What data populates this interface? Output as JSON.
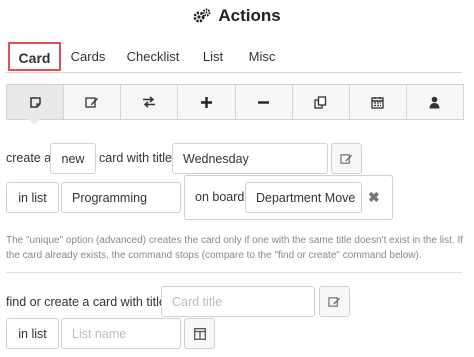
{
  "header": {
    "title": "Actions",
    "icon": "gears-icon"
  },
  "tabs": [
    {
      "label": "Card",
      "active": true
    },
    {
      "label": "Cards"
    },
    {
      "label": "Checklist"
    },
    {
      "label": "List"
    },
    {
      "label": "Misc"
    }
  ],
  "toolbar": {
    "icons": [
      "note-icon",
      "edit-icon",
      "swap-icon",
      "plus-icon",
      "minus-icon",
      "copy-icon",
      "calendar-icon",
      "user-icon"
    ]
  },
  "create_card": {
    "prefix": "create a",
    "mode_value": "new",
    "with_title_label": "card with title",
    "title_value": "Wednesday",
    "in_list_label": "in list",
    "list_value": "Programming",
    "on_board_label": "on board",
    "board_value": "Department Move",
    "remove_symbol": "✖"
  },
  "note": "The \"unique\" option (advanced) creates the card only if one with the same title doesn't exist in the list. If the card already exists, the command stops (compare to the \"find or create\" command below).",
  "find_or_create": {
    "label": "find or create a card with title",
    "title_placeholder": "Card title",
    "in_list_label": "in list",
    "list_placeholder": "List name"
  },
  "colors": {
    "active_tab_border": "#e05252",
    "toolbar_bg": "#f6f6f6",
    "muted_text": "#888888"
  }
}
